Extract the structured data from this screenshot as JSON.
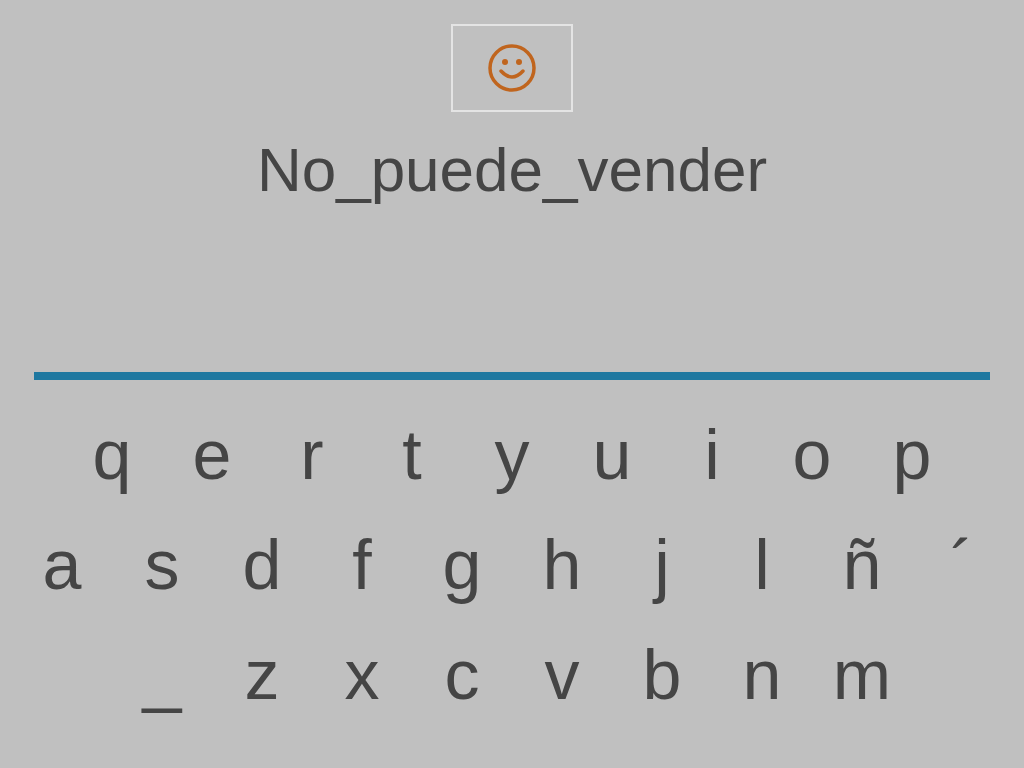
{
  "title": "No_puede_vender",
  "keyboard": {
    "rows": [
      [
        "q",
        "e",
        "r",
        "t",
        "y",
        "u",
        "i",
        "o",
        "p"
      ],
      [
        "a",
        "s",
        "d",
        "f",
        "g",
        "h",
        "j",
        "l",
        "ñ",
        "´"
      ],
      [
        "_",
        "z",
        "x",
        "c",
        "v",
        "b",
        "n",
        "m"
      ]
    ]
  }
}
